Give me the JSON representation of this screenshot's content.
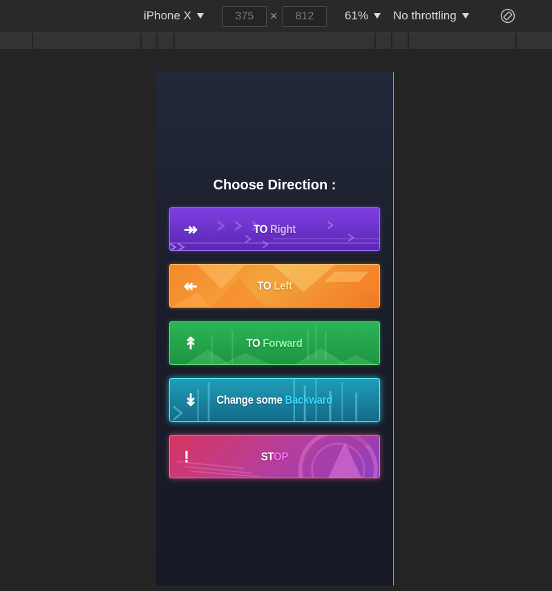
{
  "toolbar": {
    "device": "iPhone X",
    "width": "375",
    "height": "812",
    "times": "×",
    "zoom": "61%",
    "throttling": "No throttling"
  },
  "page": {
    "heading": "Choose Direction :",
    "buttons": [
      {
        "arrow": "↠",
        "prefix": "TO ",
        "highlight": "Right"
      },
      {
        "arrow": "↞",
        "prefix": "TO ",
        "highlight": "Left"
      },
      {
        "arrow": "↟",
        "prefix": "TO ",
        "highlight": "Forward"
      },
      {
        "arrow": "↡",
        "prefix": "Change some ",
        "highlight": "Backward"
      },
      {
        "arrow": "!",
        "prefix": "ST",
        "highlight": "OP"
      }
    ]
  },
  "colors": {
    "right_accent": "#d7b4ff",
    "left_accent": "#ffe28a",
    "forward_accent": "#8dfca8",
    "backward_accent": "#35d9ff",
    "stop_accent": "#ff6bff"
  },
  "icons": {
    "right": "double-arrow-right-icon",
    "left": "double-arrow-left-icon",
    "forward": "double-arrow-up-icon",
    "backward": "double-arrow-down-icon",
    "stop": "exclamation-icon",
    "rotate": "rotate-device-icon"
  }
}
